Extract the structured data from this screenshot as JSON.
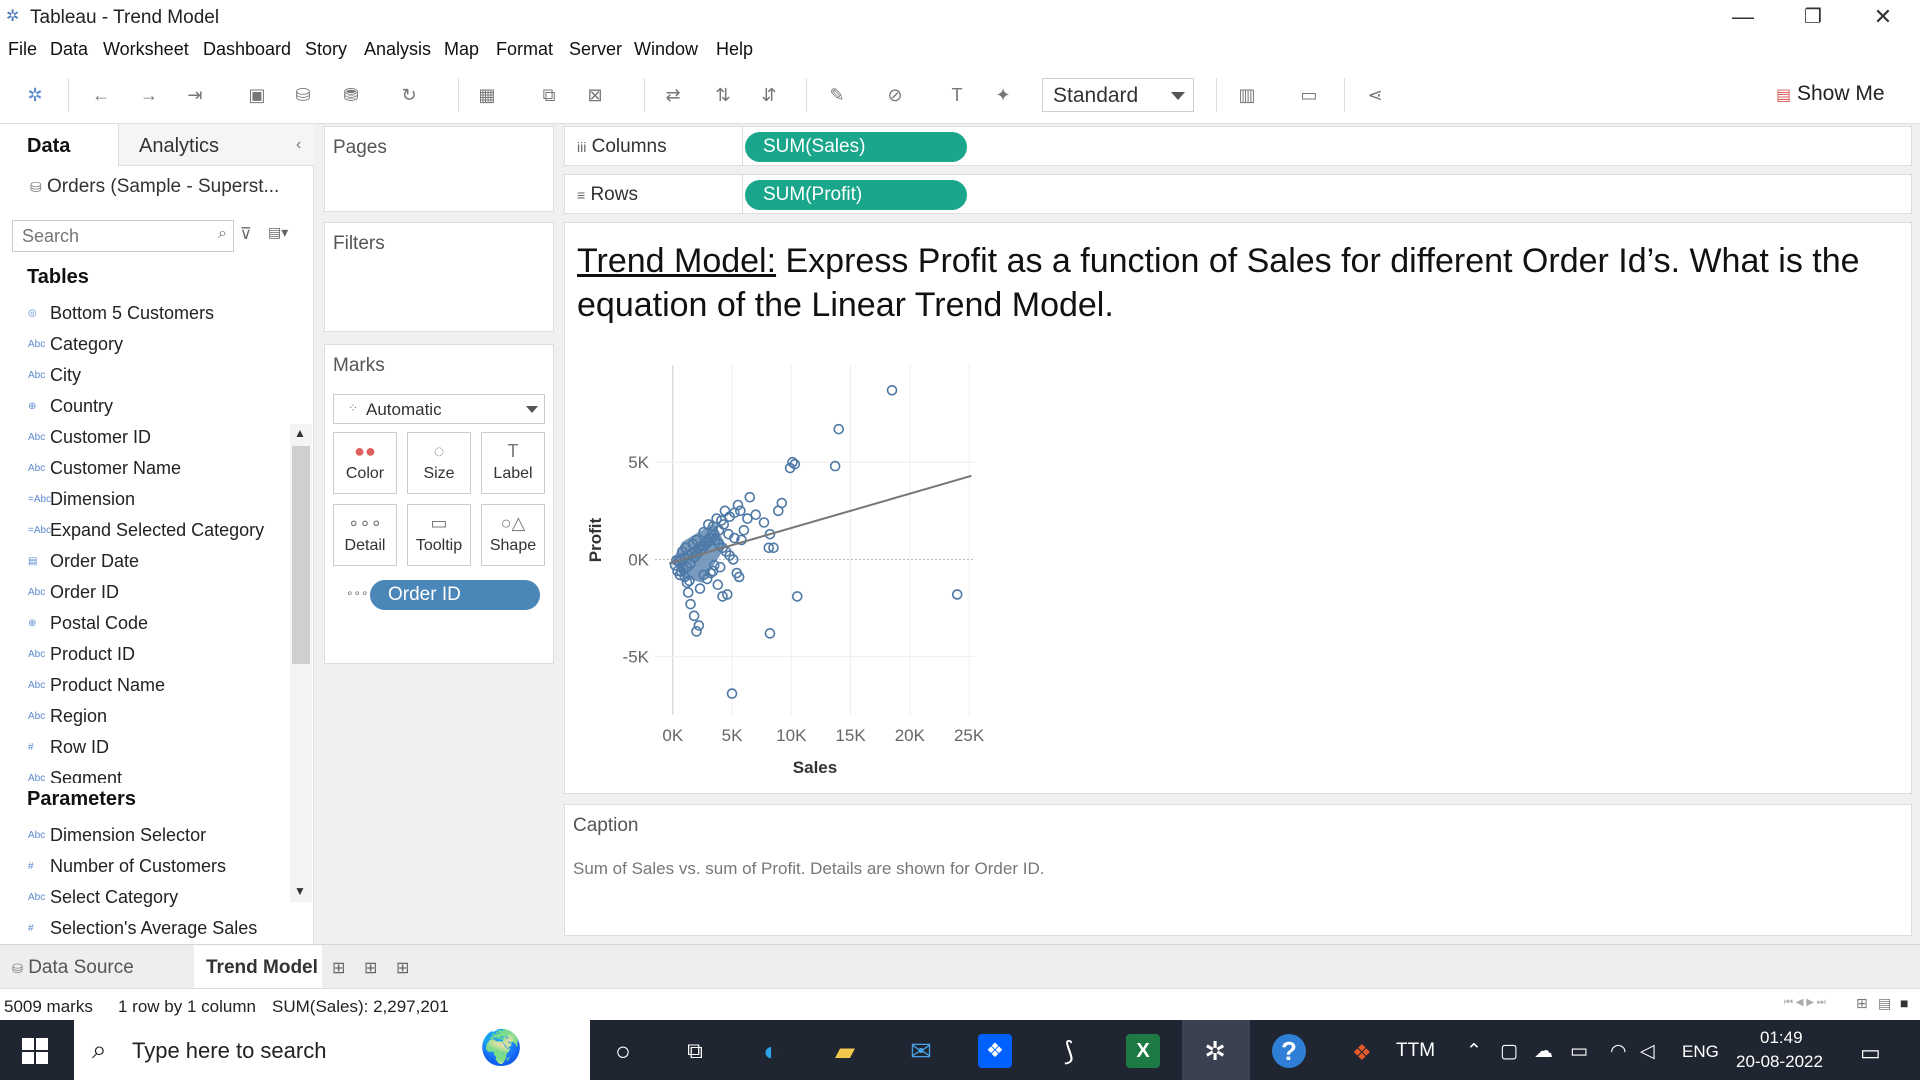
{
  "window": {
    "title": "Tableau - Trend Model",
    "minimize": "—",
    "restore": "❐",
    "close": "✕"
  },
  "menu": [
    "File",
    "Data",
    "Worksheet",
    "Dashboard",
    "Story",
    "Analysis",
    "Map",
    "Format",
    "Server",
    "Window",
    "Help"
  ],
  "toolbar": {
    "fit_value": "Standard",
    "show_me_label": "Show Me"
  },
  "data_pane": {
    "tabs": [
      "Data",
      "Analytics"
    ],
    "datasource": "Orders (Sample - Superst...",
    "search_placeholder": "Search",
    "tables_heading": "Tables",
    "tables": [
      {
        "icon": "set-icon",
        "glyph": "◎",
        "label": "Bottom 5 Customers"
      },
      {
        "icon": "abc-icon",
        "glyph": "Abc",
        "label": "Category"
      },
      {
        "icon": "abc-icon",
        "glyph": "Abc",
        "label": "City"
      },
      {
        "icon": "globe-icon",
        "glyph": "⊕",
        "label": "Country"
      },
      {
        "icon": "abc-icon",
        "glyph": "Abc",
        "label": "Customer ID"
      },
      {
        "icon": "abc-icon",
        "glyph": "Abc",
        "label": "Customer Name"
      },
      {
        "icon": "calc-abc-icon",
        "glyph": "=Abc",
        "label": "Dimension"
      },
      {
        "icon": "calc-abc-icon",
        "glyph": "=Abc",
        "label": "Expand Selected Category"
      },
      {
        "icon": "date-icon",
        "glyph": "▤",
        "label": "Order Date"
      },
      {
        "icon": "abc-icon",
        "glyph": "Abc",
        "label": "Order ID"
      },
      {
        "icon": "globe-icon",
        "glyph": "⊕",
        "label": "Postal Code"
      },
      {
        "icon": "abc-icon",
        "glyph": "Abc",
        "label": "Product ID"
      },
      {
        "icon": "abc-icon",
        "glyph": "Abc",
        "label": "Product Name"
      },
      {
        "icon": "abc-icon",
        "glyph": "Abc",
        "label": "Region"
      },
      {
        "icon": "number-icon",
        "glyph": "#",
        "label": "Row ID"
      },
      {
        "icon": "abc-icon",
        "glyph": "Abc",
        "label": "Segment"
      }
    ],
    "parameters_heading": "Parameters",
    "parameters": [
      {
        "icon": "abc-icon",
        "glyph": "Abc",
        "label": "Dimension Selector"
      },
      {
        "icon": "number-icon",
        "glyph": "#",
        "label": "Number of Customers"
      },
      {
        "icon": "abc-icon",
        "glyph": "Abc",
        "label": "Select Category"
      },
      {
        "icon": "number-icon",
        "glyph": "#",
        "label": "Selection's Average Sales"
      }
    ]
  },
  "cards": {
    "pages": "Pages",
    "filters": "Filters",
    "marks": "Marks",
    "mark_type": "Automatic",
    "mark_buttons": [
      {
        "name": "color",
        "label": "Color",
        "glyph": "●●"
      },
      {
        "name": "size",
        "label": "Size",
        "glyph": "◌"
      },
      {
        "name": "label",
        "label": "Label",
        "glyph": "T"
      },
      {
        "name": "detail",
        "label": "Detail",
        "glyph": "∘∘∘"
      },
      {
        "name": "tooltip",
        "label": "Tooltip",
        "glyph": "▭"
      },
      {
        "name": "shape",
        "label": "Shape",
        "glyph": "○△"
      }
    ],
    "detail_pill": "Order ID"
  },
  "shelves": {
    "columns_label": "Columns",
    "columns_pill": "SUM(Sales)",
    "rows_label": "Rows",
    "rows_pill": "SUM(Profit)"
  },
  "view": {
    "headline_underlined": "Trend Model:",
    "headline_rest": " Express Profit as a function of Sales for different Order Id’s. What is the equation of the Linear Trend Model."
  },
  "chart_data": {
    "type": "scatter",
    "xlabel": "Sales",
    "ylabel": "Profit",
    "xlim": [
      -1500,
      25500
    ],
    "ylim": [
      -8000,
      10000
    ],
    "xticks": [
      {
        "v": 0,
        "label": "0K"
      },
      {
        "v": 5000,
        "label": "5K"
      },
      {
        "v": 10000,
        "label": "10K"
      },
      {
        "v": 15000,
        "label": "15K"
      },
      {
        "v": 20000,
        "label": "20K"
      },
      {
        "v": 25000,
        "label": "25K"
      }
    ],
    "yticks": [
      {
        "v": 5000,
        "label": "5K"
      },
      {
        "v": 0,
        "label": "0K"
      },
      {
        "v": -5000,
        "label": "-5K"
      }
    ],
    "grid": true,
    "trend_line": {
      "x": [
        -300,
        25200
      ],
      "y": [
        -200,
        4300
      ]
    },
    "mark_color": "#4e79a7",
    "points": [
      [
        18500,
        8700
      ],
      [
        14000,
        6700
      ],
      [
        13700,
        4800
      ],
      [
        10300,
        4900
      ],
      [
        9900,
        4700
      ],
      [
        10100,
        5000
      ],
      [
        6500,
        3200
      ],
      [
        9200,
        2900
      ],
      [
        8900,
        2500
      ],
      [
        7000,
        2300
      ],
      [
        7700,
        1900
      ],
      [
        8200,
        1300
      ],
      [
        8500,
        600
      ],
      [
        8100,
        600
      ],
      [
        24000,
        -1800
      ],
      [
        10500,
        -1900
      ],
      [
        8200,
        -3800
      ],
      [
        5000,
        -6900
      ],
      [
        2000,
        -3700
      ],
      [
        2200,
        -3400
      ],
      [
        1800,
        -2900
      ],
      [
        1500,
        -2300
      ],
      [
        1300,
        -1700
      ],
      [
        1200,
        -1200
      ],
      [
        4200,
        -1900
      ],
      [
        4600,
        -1800
      ],
      [
        3800,
        -1300
      ],
      [
        5400,
        -700
      ],
      [
        5600,
        -900
      ],
      [
        3400,
        -600
      ],
      [
        6000,
        1500
      ],
      [
        5700,
        2500
      ],
      [
        5200,
        2400
      ],
      [
        5500,
        2800
      ],
      [
        4800,
        2200
      ],
      [
        4300,
        1800
      ],
      [
        3900,
        1500
      ],
      [
        3500,
        1300
      ],
      [
        3100,
        1100
      ],
      [
        2800,
        900
      ],
      [
        2500,
        700
      ],
      [
        2200,
        600
      ],
      [
        1900,
        400
      ],
      [
        1600,
        300
      ],
      [
        1300,
        200
      ],
      [
        1000,
        100
      ],
      [
        700,
        0
      ],
      [
        500,
        -100
      ],
      [
        300,
        -50
      ],
      [
        200,
        -300
      ],
      [
        400,
        -600
      ],
      [
        600,
        -800
      ],
      [
        900,
        -500
      ],
      [
        1200,
        -400
      ],
      [
        1500,
        -200
      ],
      [
        1800,
        100
      ],
      [
        2100,
        300
      ],
      [
        2400,
        500
      ],
      [
        2700,
        700
      ],
      [
        3000,
        900
      ],
      [
        3300,
        1100
      ],
      [
        3600,
        1000
      ],
      [
        3900,
        800
      ],
      [
        4200,
        600
      ],
      [
        4500,
        400
      ],
      [
        4800,
        200
      ],
      [
        5100,
        0
      ],
      [
        2600,
        -800
      ],
      [
        2900,
        -1000
      ],
      [
        3200,
        -700
      ],
      [
        3500,
        -300
      ],
      [
        1000,
        -900
      ],
      [
        1400,
        -1100
      ],
      [
        700,
        -600
      ],
      [
        2300,
        -1500
      ],
      [
        4000,
        -400
      ],
      [
        5200,
        1100
      ],
      [
        6300,
        2100
      ],
      [
        4700,
        1300
      ],
      [
        4400,
        2500
      ],
      [
        3700,
        2100
      ],
      [
        3400,
        1700
      ],
      [
        2000,
        1000
      ],
      [
        2600,
        1400
      ],
      [
        1700,
        800
      ],
      [
        800,
        400
      ],
      [
        1100,
        600
      ],
      [
        3000,
        1800
      ],
      [
        4100,
        2000
      ],
      [
        5800,
        1000
      ]
    ]
  },
  "caption": {
    "title": "Caption",
    "text": "Sum of Sales vs. sum of Profit.  Details are shown for Order ID."
  },
  "sheet_tabs": {
    "data_source": "Data Source",
    "active": "Trend Model"
  },
  "status": {
    "marks": "5009 marks",
    "dims": "1 row by 1 column",
    "sum": "SUM(Sales): 2,297,201"
  },
  "taskbar": {
    "search_placeholder": "Type here to search",
    "ttm": "TTM",
    "lang": "ENG",
    "time": "01:49",
    "date": "20-08-2022"
  }
}
